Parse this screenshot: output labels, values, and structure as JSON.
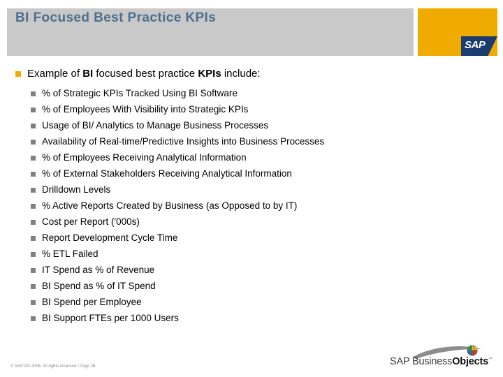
{
  "header": {
    "title": "BI Focused Best Practice KPIs",
    "title_color": "#4b6f8c",
    "band_color": "#c9c9c9",
    "accent_color": "#f0ab00",
    "logo_text": "SAP"
  },
  "content": {
    "lead_in": {
      "prefix": "Example of ",
      "bold1": "BI",
      "middle": " focused best practice ",
      "bold2": "KPIs",
      "suffix": " include:"
    },
    "bullet_color": "#f0ab00",
    "sub_bullet_color": "#7f7f7f",
    "items": [
      "% of Strategic KPIs Tracked Using BI Software",
      "% of Employees With Visibility into Strategic KPIs",
      "Usage of BI/ Analytics to Manage Business Processes",
      "Availability of Real-time/Predictive Insights into Business Processes",
      "% of Employees Receiving Analytical Information",
      "% of External Stakeholders Receiving Analytical Information",
      "Drilldown Levels",
      "% Active Reports Created by Business (as Opposed to by IT)",
      "Cost per Report ('000s)",
      "Report Development Cycle Time",
      "% ETL Failed",
      "IT Spend as % of Revenue",
      "BI Spend as % of IT Spend",
      "BI Spend per Employee",
      "BI Support FTEs per 1000 Users"
    ]
  },
  "footer": {
    "copyright": "© SAP AG 2008. All rights reserved / Page 26",
    "brand_regular": "SAP Business",
    "brand_bold": "Objects",
    "trademark": "™"
  }
}
